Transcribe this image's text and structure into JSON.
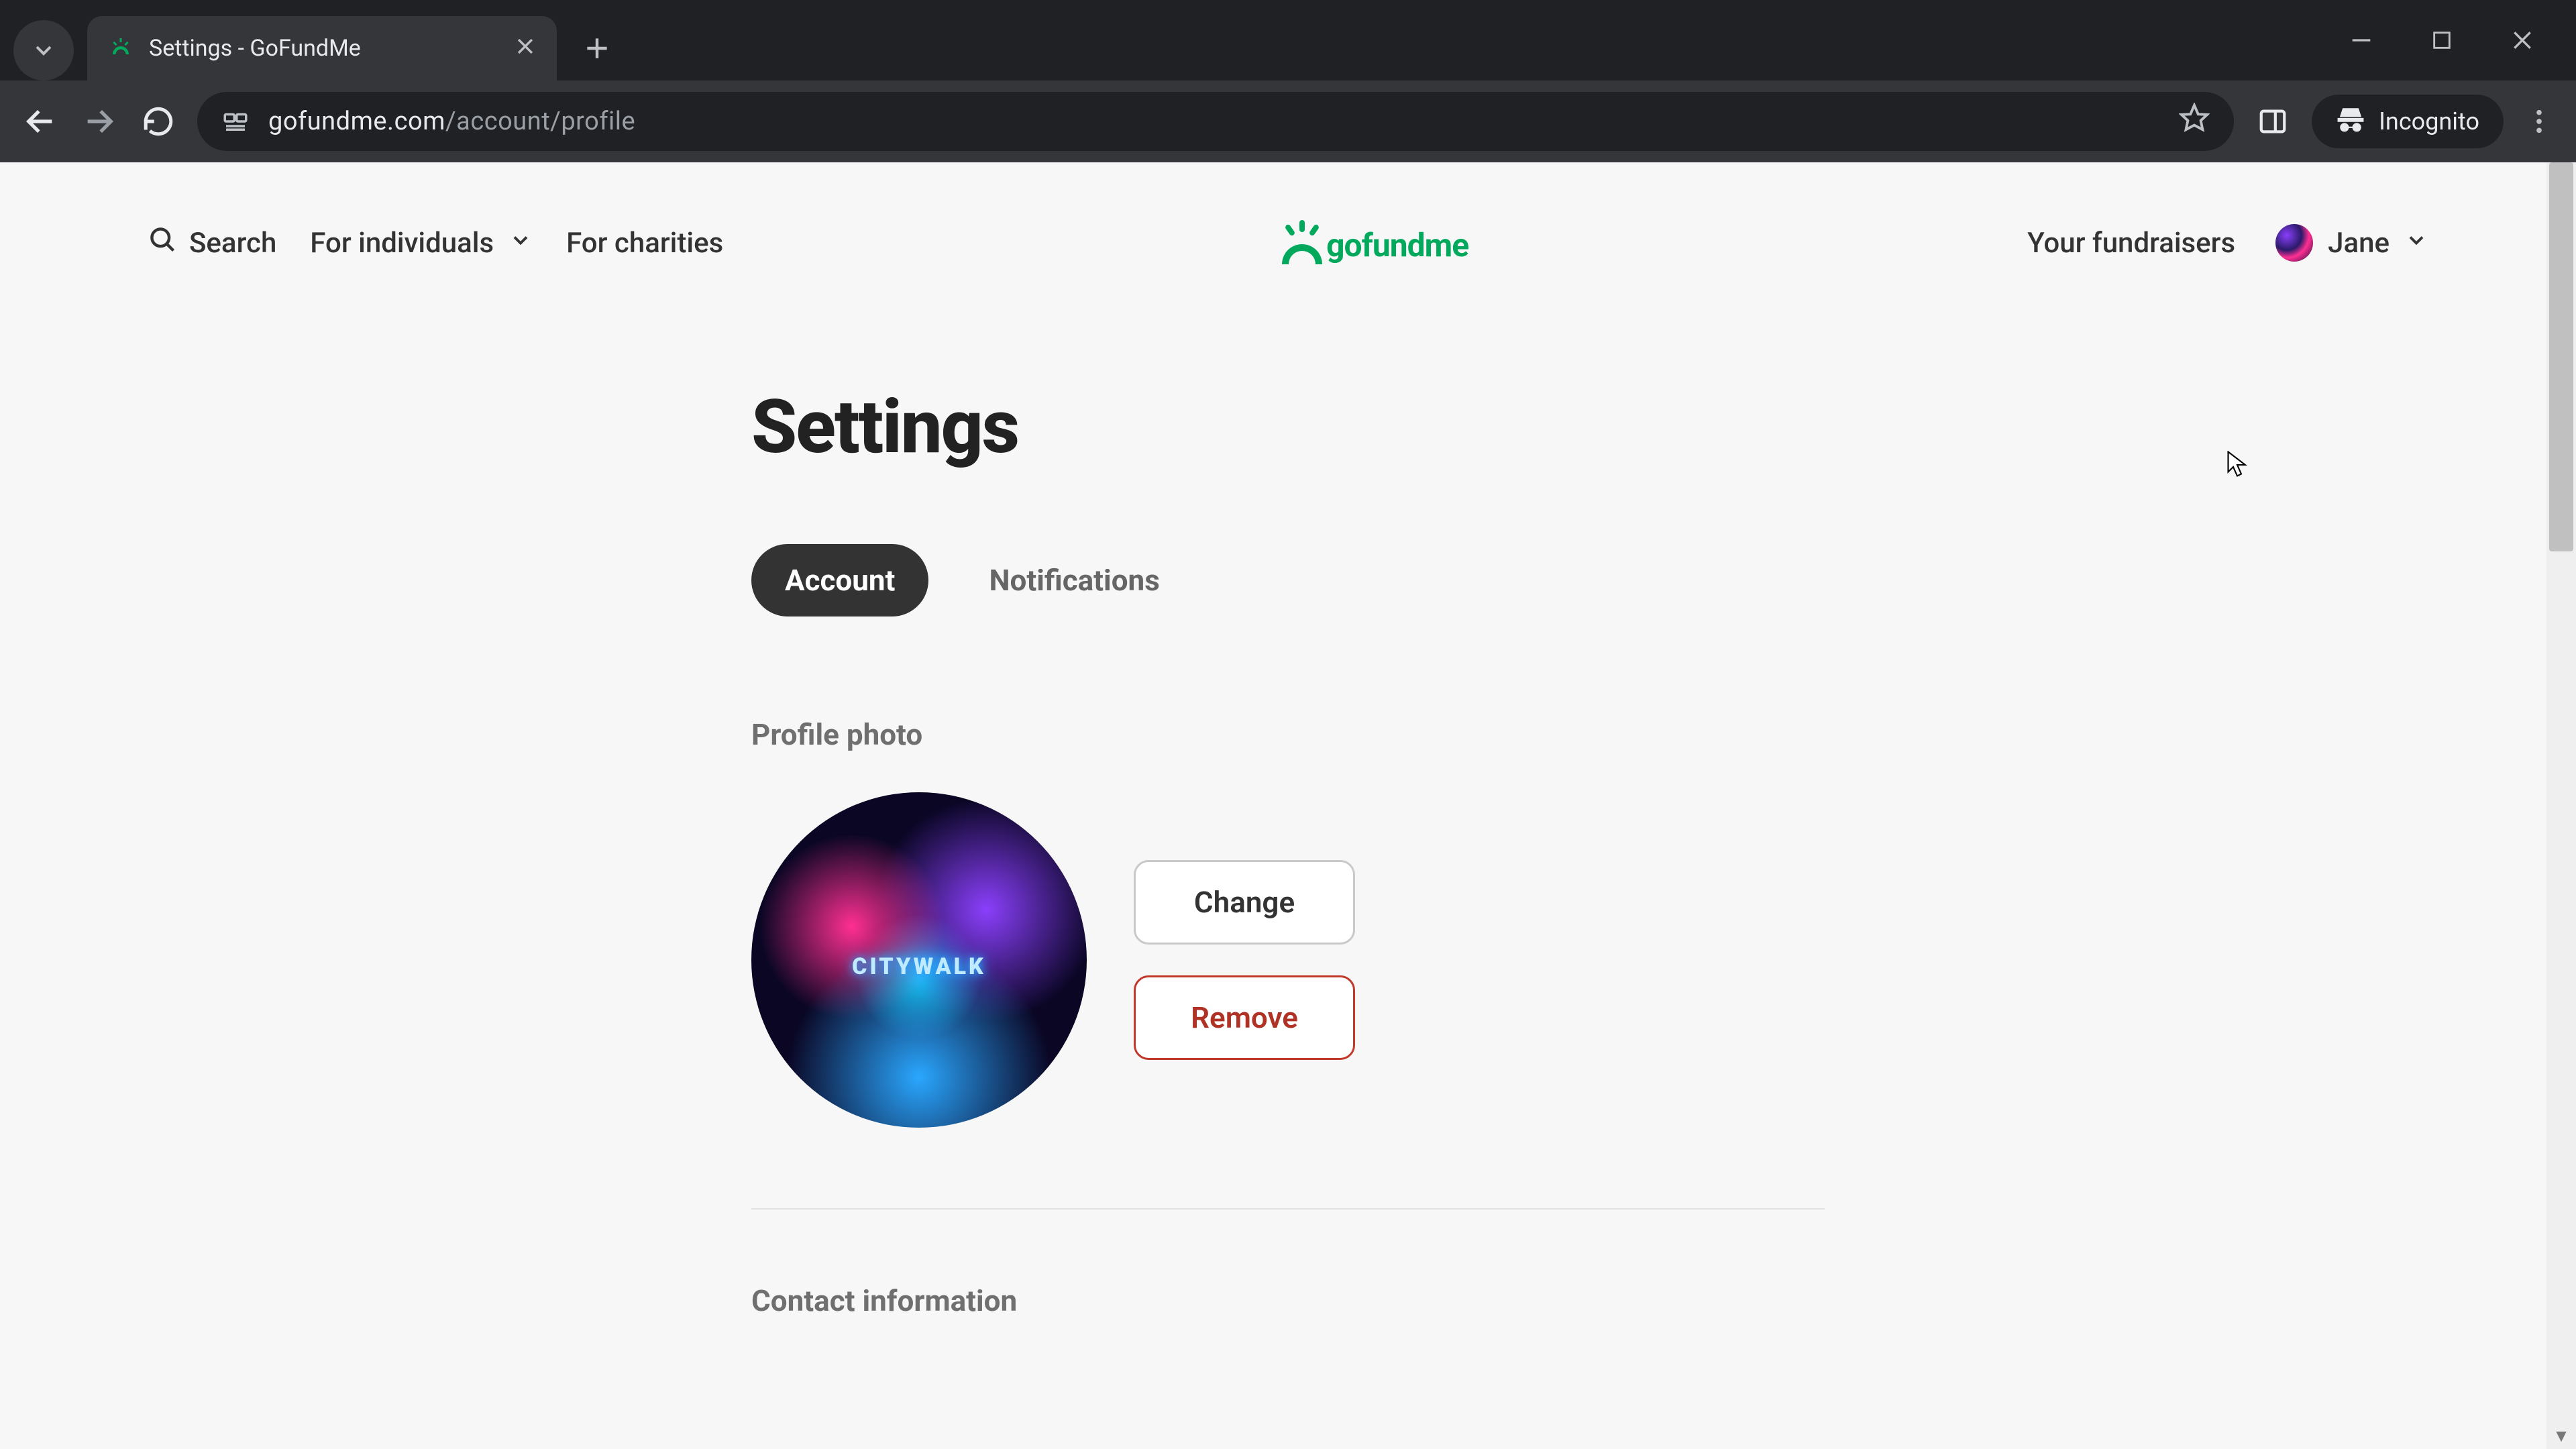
{
  "browser": {
    "tab_title": "Settings - GoFundMe",
    "url_host": "gofundme.com",
    "url_path": "/account/profile",
    "incognito_label": "Incognito"
  },
  "header": {
    "search": "Search",
    "for_individuals": "For individuals",
    "for_charities": "For charities",
    "logo_text": "gofundme",
    "your_fundraisers": "Your fundraisers",
    "user_name": "Jane"
  },
  "page": {
    "title": "Settings",
    "tabs": {
      "account": "Account",
      "notifications": "Notifications"
    },
    "profile_photo_label": "Profile photo",
    "avatar_text": "CITYWALK",
    "change_btn": "Change",
    "remove_btn": "Remove",
    "contact_label": "Contact information"
  }
}
